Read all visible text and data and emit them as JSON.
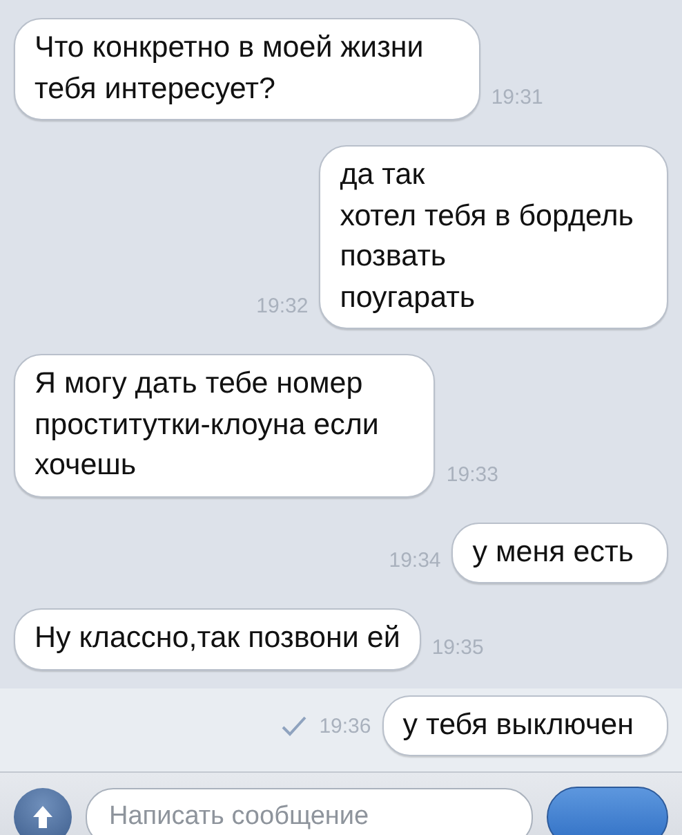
{
  "messages": [
    {
      "kind": "incoming",
      "lines": [
        "Что конкретно в моей жизни",
        "тебя интересует?"
      ],
      "time": "19:31",
      "highlighted": false
    },
    {
      "kind": "outgoing",
      "lines": [
        "да так",
        "хотел тебя в бордель",
        "позвать",
        "поугарать"
      ],
      "time": "19:32",
      "read": false,
      "highlighted": false
    },
    {
      "kind": "incoming",
      "lines": [
        "Я могу дать тебе номер",
        "проститутки-клоуна если",
        "хочешь"
      ],
      "time": "19:33",
      "highlighted": false
    },
    {
      "kind": "outgoing",
      "lines": [
        "у меня есть"
      ],
      "time": "19:34",
      "read": false,
      "highlighted": false
    },
    {
      "kind": "incoming",
      "lines": [
        "Ну классно,так позвони ей"
      ],
      "time": "19:35",
      "highlighted": false
    },
    {
      "kind": "outgoing",
      "lines": [
        "у тебя выключен"
      ],
      "time": "19:36",
      "read": true,
      "highlighted": true
    }
  ],
  "composer": {
    "placeholder": "Написать сообщение"
  }
}
